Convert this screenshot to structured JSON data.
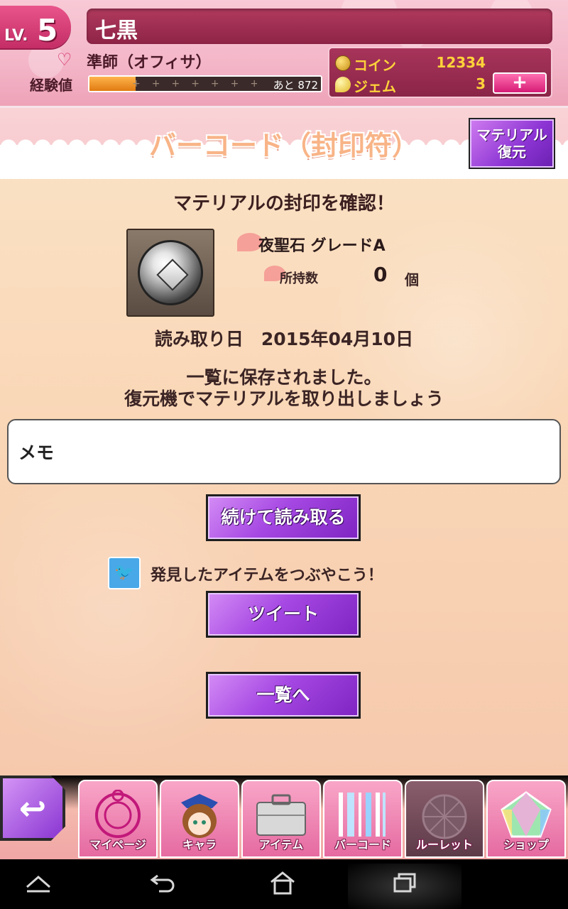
{
  "header": {
    "level_prefix": "LV.",
    "level": "5",
    "player_name": "七黒",
    "rank": "準師（オフィサ）",
    "exp_label": "経験値",
    "exp_remaining": "あと 872",
    "exp_progress": 0.2,
    "coin_label": "コイン",
    "coin_value": "12334",
    "gem_label": "ジェム",
    "gem_value": "3",
    "gem_add": "+"
  },
  "page": {
    "title": "バーコード（封印符）",
    "restore_button": {
      "line1": "マテリアル",
      "line2": "復元"
    }
  },
  "result": {
    "heading": "マテリアルの封印を確認！",
    "item_name": "夜聖石 グレードA",
    "owned_label": "所持数",
    "owned_count": "0",
    "owned_unit": "個",
    "read_date": "読み取り日　2015年04月10日",
    "saved_line1": "一覧に保存されました。",
    "saved_line2": "復元機でマテリアルを取り出しましょう",
    "memo_label": "メモ"
  },
  "actions": {
    "continue_label": "続けて読み取る",
    "tweet_prompt": "発見したアイテムをつぶやこう！",
    "tweet_label": "ツイート",
    "list_label": "一覧へ"
  },
  "nav": {
    "back_icon": "↩",
    "tabs": [
      {
        "label": "マイページ",
        "icon": "mypage-emblem-icon"
      },
      {
        "label": "キャラ",
        "icon": "character-icon"
      },
      {
        "label": "アイテム",
        "icon": "briefcase-icon"
      },
      {
        "label": "バーコード",
        "icon": "barcode-icon"
      },
      {
        "label": "ルーレット",
        "icon": "roulette-icon"
      },
      {
        "label": "ショップ",
        "icon": "gem-icon"
      }
    ]
  },
  "colors": {
    "accent_purple": "#a648e3",
    "header_pink": "#f3b6c8",
    "currency_gold": "#ffd23a"
  }
}
